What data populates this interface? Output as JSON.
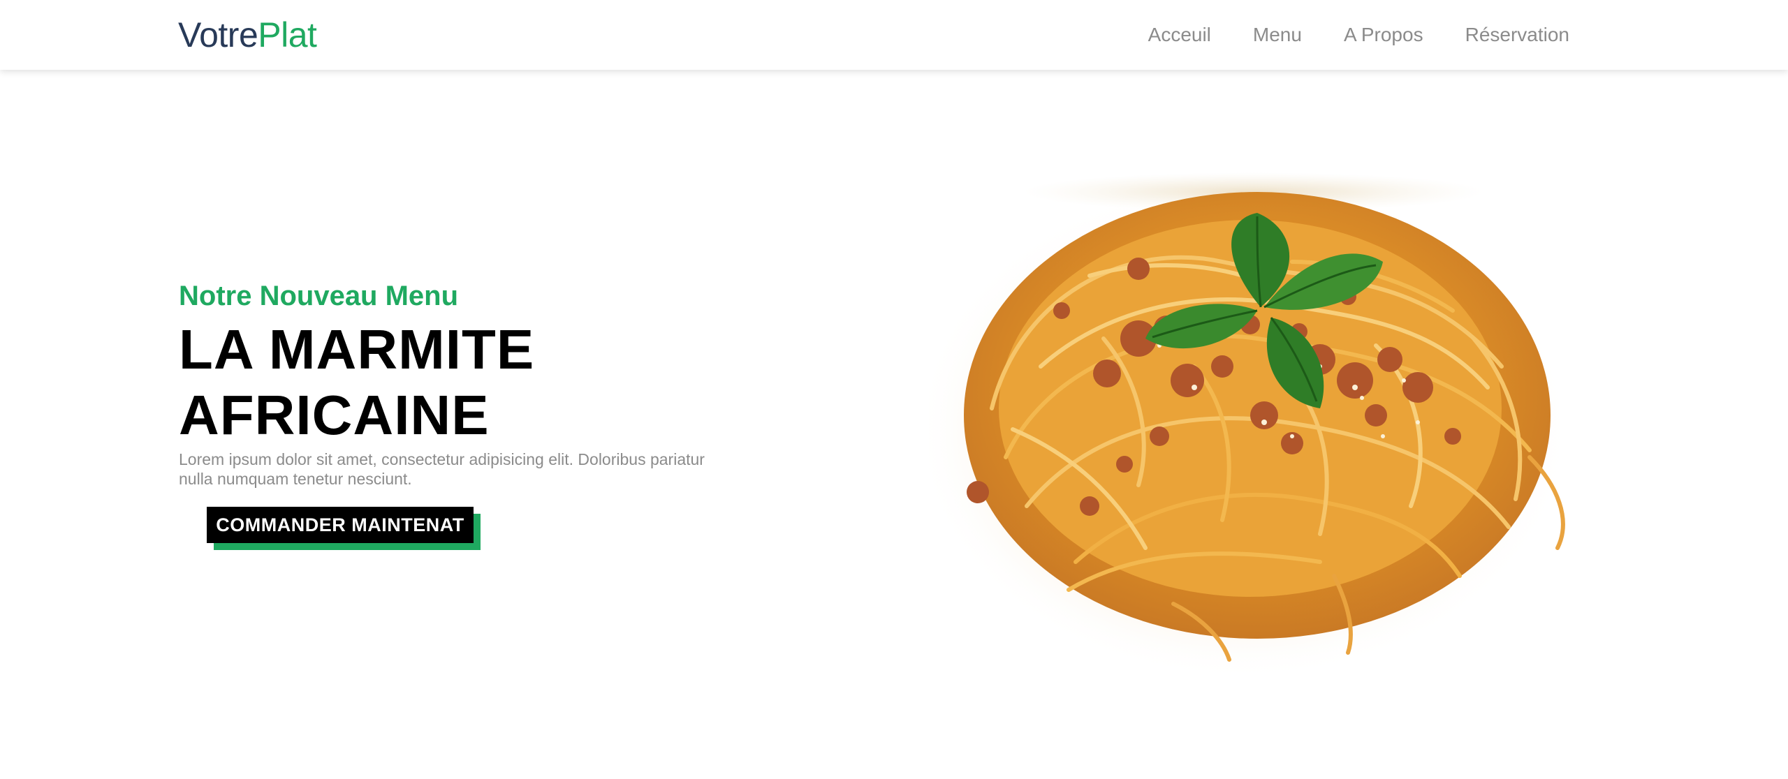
{
  "navbar": {
    "logo": {
      "part_a": "Votre",
      "part_b": "Plat"
    },
    "links": [
      "Acceuil",
      "Menu",
      "A Propos",
      "Réservation"
    ]
  },
  "hero": {
    "subtitle": "Notre Nouveau Menu",
    "title_line1": "LA MARMITE",
    "title_line2": "AFRICAINE",
    "description": "Lorem ipsum dolor sit amet, consectetur adipisicing elit. Doloribus pariatur nulla numquam tenetur nesciunt.",
    "cta_label": "COMMANDER MAINTENAT",
    "image_alt": "spaghetti-bolognese-plate"
  },
  "colors": {
    "accent": "#1fa960",
    "logo_dark": "#283a58",
    "nav_text": "#8b8b8b",
    "button_bg": "#000000"
  }
}
